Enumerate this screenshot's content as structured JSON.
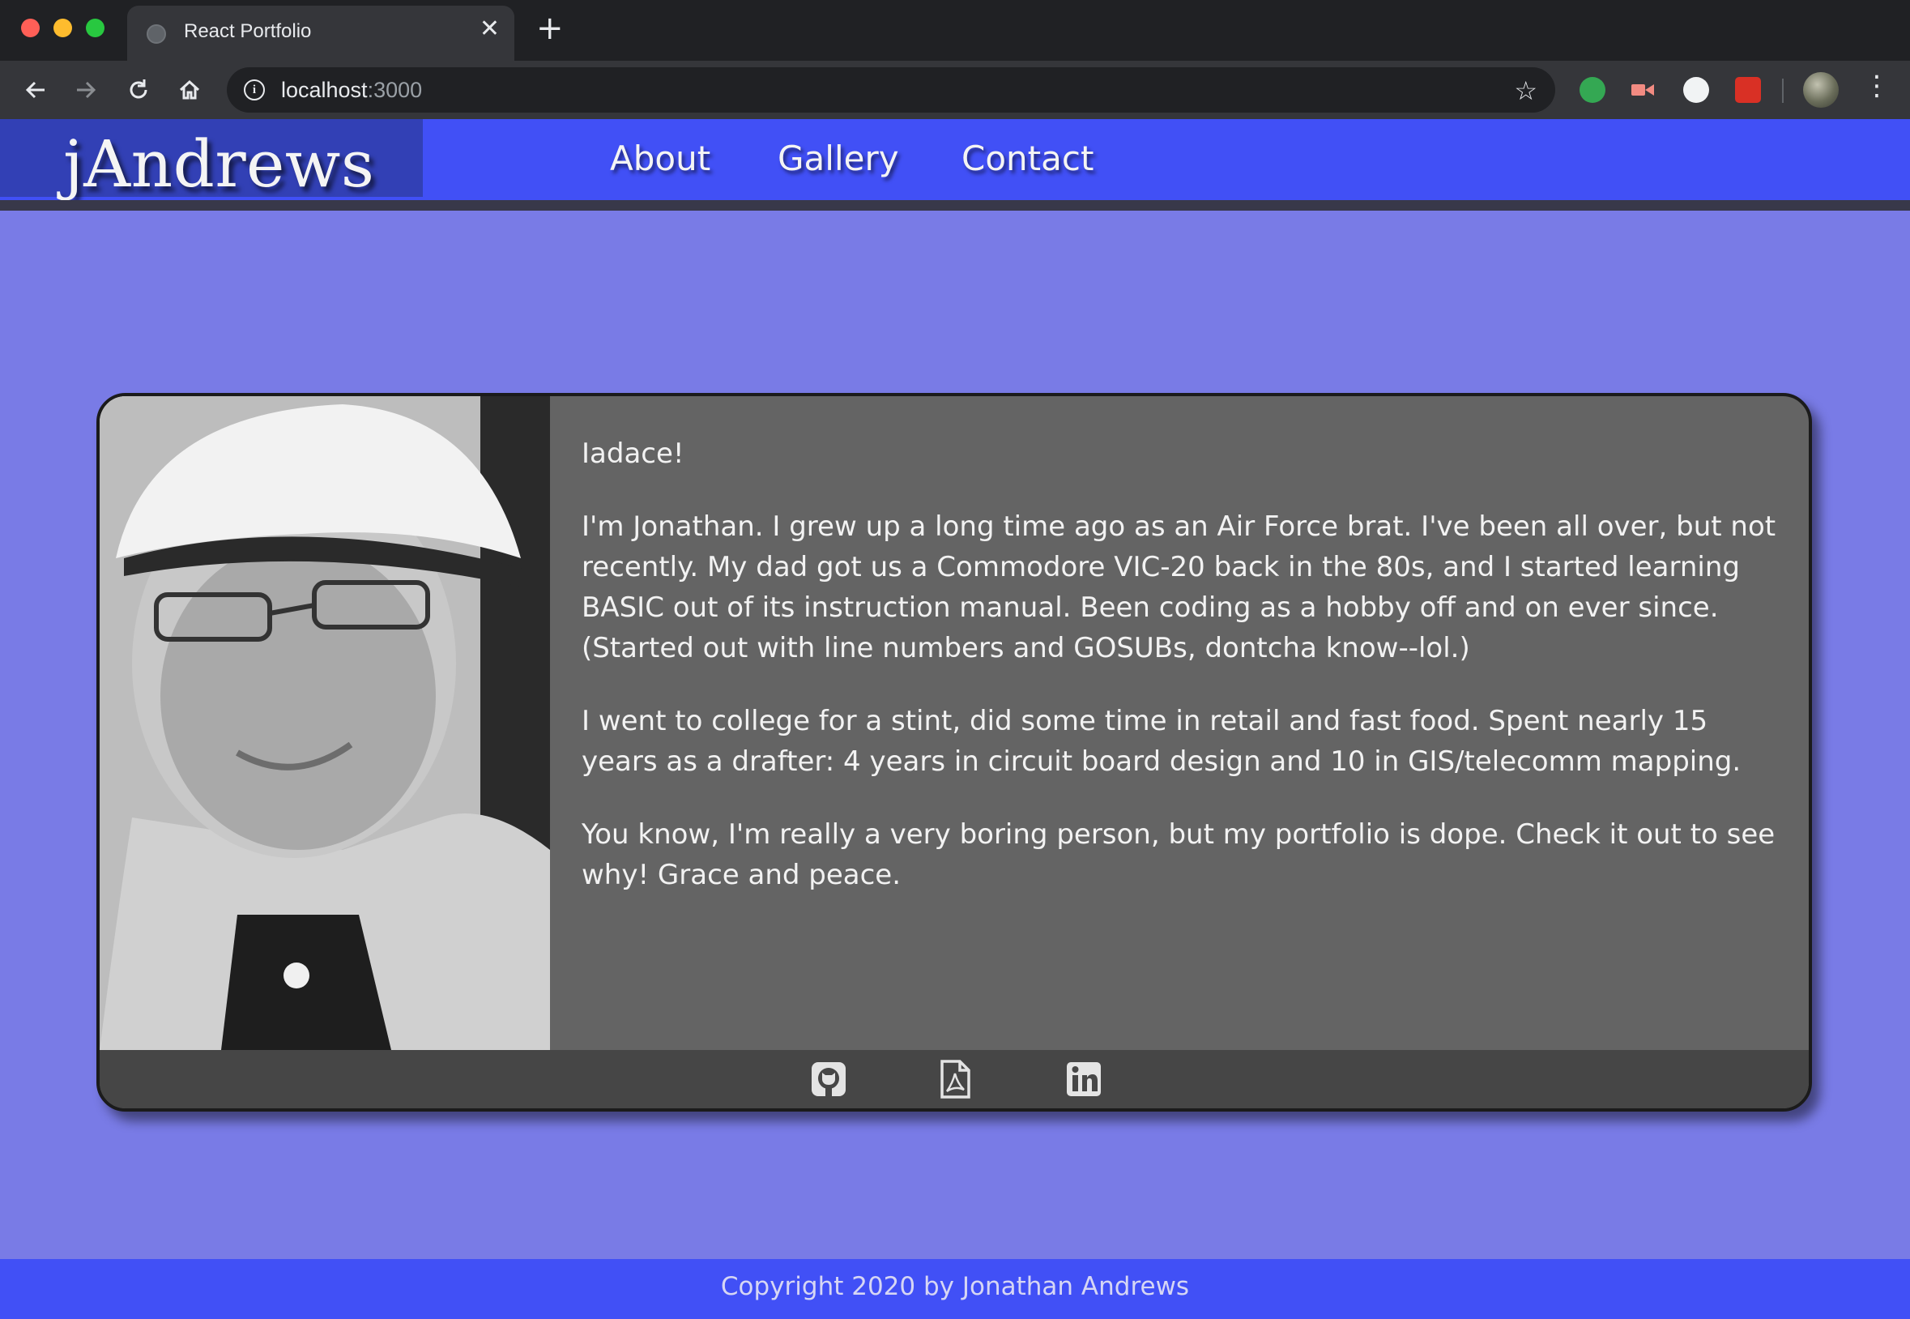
{
  "browser": {
    "tab_title": "React Portfolio",
    "url_host": "localhost",
    "url_port": ":3000"
  },
  "header": {
    "brand": "jAndrews",
    "nav": [
      "About",
      "Gallery",
      "Contact"
    ]
  },
  "about": {
    "paragraphs": [
      "Iadace!",
      "I'm Jonathan. I grew up a long time ago as an Air Force brat. I've been all over, but not recently. My dad got us a Commodore VIC-20 back in the 80s, and I started learning BASIC out of its instruction manual. Been coding as a hobby off and on ever since. (Started out with line numbers and GOSUBs, dontcha know--lol.)",
      "I went to college for a stint, did some time in retail and fast food. Spent nearly 15 years as a drafter: 4 years in circuit board design and 10 in GIS/telecomm mapping.",
      "You know, I'm really a very boring person, but my portfolio is dope. Check it out to see why! Grace and peace."
    ],
    "social_icons": [
      "github-icon",
      "pdf-resume-icon",
      "linkedin-icon"
    ]
  },
  "footer": {
    "copyright": "Copyright 2020 by Jonathan Andrews"
  },
  "colors": {
    "page_bg": "#797be6",
    "header_bg": "#4150f6",
    "brand_bg": "#3240b5",
    "card_bg": "#646464",
    "card_footer_bg": "#464646"
  }
}
